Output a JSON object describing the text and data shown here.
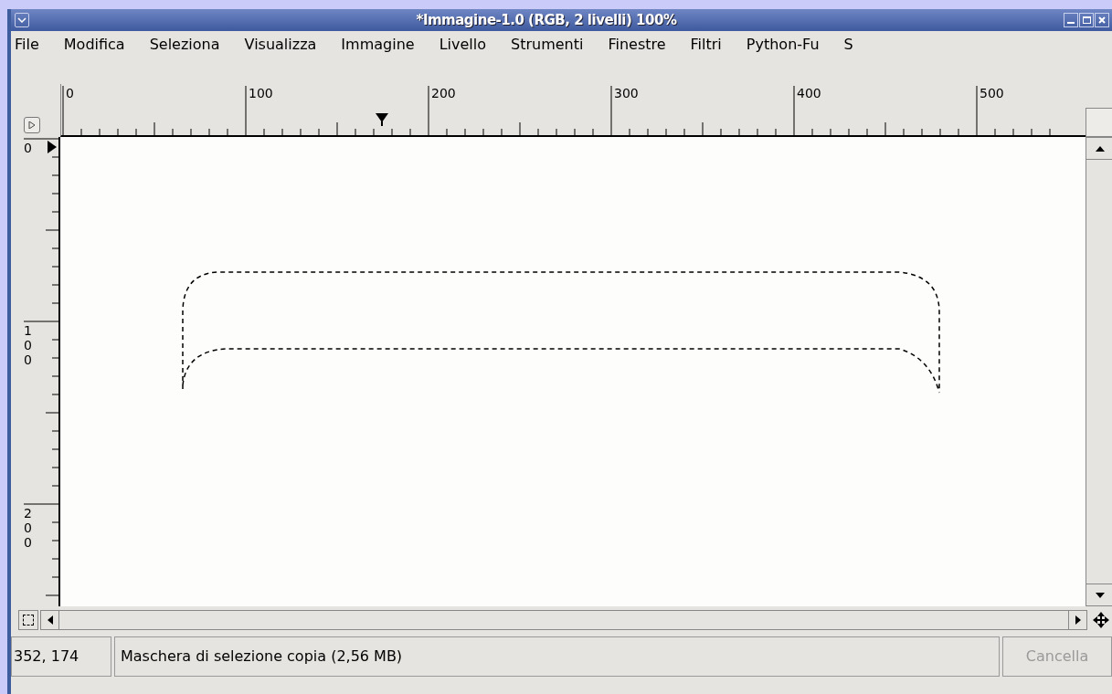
{
  "window": {
    "title": "*Immagine-1.0 (RGB, 2 livelli) 100%"
  },
  "menu": [
    {
      "label": "File"
    },
    {
      "label": "Modifica"
    },
    {
      "label": "Seleziona"
    },
    {
      "label": "Visualizza"
    },
    {
      "label": "Immagine"
    },
    {
      "label": "Livello"
    },
    {
      "label": "Strumenti"
    },
    {
      "label": "Finestre"
    },
    {
      "label": "Filtri"
    },
    {
      "label": "Python-Fu"
    },
    {
      "label": "S"
    }
  ],
  "top_ruler": {
    "labels": [
      "0",
      "100",
      "200",
      "300",
      "400",
      "500"
    ]
  },
  "left_ruler": {
    "labels": [
      "0",
      "100",
      "200"
    ]
  },
  "status_bar": {
    "coordinates": "352, 174",
    "message": "Maschera di selezione copia (2,56 MB)",
    "cancel_button": {
      "label": "Cancella",
      "disabled": true
    }
  }
}
